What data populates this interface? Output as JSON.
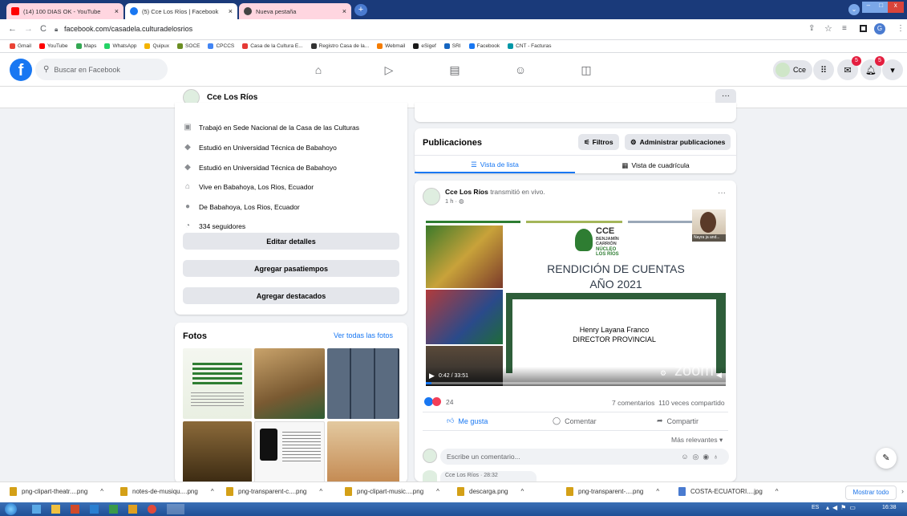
{
  "browser": {
    "tabs": [
      {
        "title": "(14) 100 DIAS OK - YouTube",
        "color": "#ff0000"
      },
      {
        "title": "(5) Cce Los Ríos | Facebook",
        "color": "#1877f2"
      },
      {
        "title": "Nueva pestaña",
        "color": "#444444"
      }
    ],
    "new_tab": "+",
    "url": "facebook.com/casadela.culturadelosrios",
    "bookmarks": [
      "Gmail",
      "YouTube",
      "Maps",
      "WhatsApp",
      "Quipux",
      "SOCE",
      "CPCCS",
      "Casa de la Cultura E...",
      "Registro Casa de la...",
      "Webmail",
      "eSigef",
      "SRI",
      "Facebook",
      "CNT - Facturas"
    ]
  },
  "facebook": {
    "search_placeholder": "Buscar en Facebook",
    "profile_short": "Cce",
    "messenger_badge": "5",
    "notifications_badge": "5",
    "page_name": "Cce Los Ríos",
    "more": "···"
  },
  "intro": {
    "rows": [
      {
        "text": "Trabajó en Sede Nacional de la Casa de las Culturas",
        "icon": "briefcase-icon"
      },
      {
        "text": "Estudió en Universidad Técnica de Babahoyo",
        "icon": "graduation-cap-icon"
      },
      {
        "text": "Estudió en Universidad Técnica de Babahoyo",
        "icon": "graduation-cap-icon"
      },
      {
        "text": "Vive en Babahoya, Los Rios, Ecuador",
        "icon": "home-icon"
      },
      {
        "text": "De Babahoya, Los Rios, Ecuador",
        "icon": "location-pin-icon"
      },
      {
        "text": "334 seguidores",
        "icon": "rss-icon"
      }
    ],
    "edit_details": "Editar detalles",
    "add_hobbies": "Agregar pasatiempos",
    "add_featured": "Agregar destacados"
  },
  "photos": {
    "title": "Fotos",
    "see_all": "Ver todas las fotos"
  },
  "posts_header": {
    "title": "Publicaciones",
    "filters": "Filtros",
    "manage": "Administrar publicaciones",
    "list_view": "Vista de lista",
    "grid_view": "Vista de cuadrícula"
  },
  "post": {
    "author": "Cce Los Ríos",
    "action": "transmitió en vivo.",
    "time": "1 h · ",
    "video": {
      "title_line1": "RENDICIÓN DE CUENTAS",
      "title_line2": "AÑO 2021",
      "person": "Henry Layana Franco",
      "role": "DIRECTOR PROVINCIAL",
      "logo_line1": "CCE",
      "logo_line2": "BENJAMÍN",
      "logo_line3": "CARRIÓN",
      "logo_line4": "NÚCLEO",
      "logo_line5": "LOS RÍOS",
      "cam_label": "Nayra ja and...",
      "timestamp": "0:42 / 33:51",
      "zoom": "zoom",
      "progress": 0.02
    },
    "reactions": "24",
    "stats": "7 comentarios  110 veces compartido",
    "like": "Me gusta",
    "comment": "Comentar",
    "share": "Compartir",
    "sort": "Más relevantes",
    "comment_placeholder": "Escribe un comentario...",
    "next_comment": "Cce Los Ríos · 28:32"
  },
  "downloads": {
    "items": [
      "png-clipart-theatr....png",
      "notes-de-musiqu....png",
      "png-transparent-c....png",
      "png-clipart-music....png",
      "descarga.png",
      "png-transparent-....png",
      "COSTA-ECUATORI....jpg"
    ],
    "show_all": "Mostrar todo"
  },
  "taskbar": {
    "lang": "ES",
    "time": "16:38"
  }
}
